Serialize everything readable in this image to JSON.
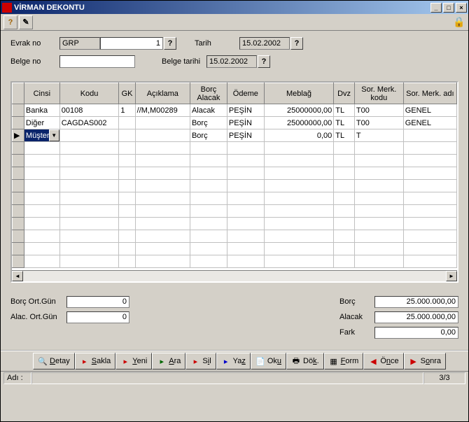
{
  "window": {
    "title": "VİRMAN DEKONTU"
  },
  "toolbar1": {
    "help": "?",
    "tool2": "✎"
  },
  "form": {
    "evrak_label": "Evrak no",
    "evrak_series": "GRP",
    "evrak_num": "1",
    "belge_label": "Belge no",
    "belge_value": "",
    "tarih_label": "Tarih",
    "tarih_value": "15.02.2002",
    "belge_tarihi_label": "Belge tarihi",
    "belge_tarihi_value": "15.02.2002"
  },
  "grid": {
    "headers": [
      "Cinsi",
      "Kodu",
      "GK",
      "Açıklama",
      "Borç Alacak",
      "Ödeme",
      "Meblağ",
      "Dvz",
      "Sor. Merk. kodu",
      "Sor. Merk. adı"
    ],
    "rows": [
      {
        "cinsi": "Banka",
        "kodu": "00108",
        "gk": "1",
        "aciklama": "//M,M00289",
        "ba": "Alacak",
        "odeme": "PEŞİN",
        "meblag": "25000000,00",
        "dvz": "TL",
        "smk": "T00",
        "sma": "GENEL"
      },
      {
        "cinsi": "Diğer",
        "kodu": "CAGDAS002",
        "gk": "",
        "aciklama": "",
        "ba": "Borç",
        "odeme": "PEŞİN",
        "meblag": "25000000,00",
        "dvz": "TL",
        "smk": "T00",
        "sma": "GENEL"
      },
      {
        "cinsi": "Müşteri",
        "kodu": "",
        "gk": "",
        "aciklama": "",
        "ba": "Borç",
        "odeme": "PEŞİN",
        "meblag": "0,00",
        "dvz": "TL",
        "smk": "T",
        "sma": ""
      }
    ]
  },
  "summary": {
    "borc_ort_label": "Borç Ort.Gün",
    "borc_ort_value": "0",
    "alac_ort_label": "Alac. Ort.Gün",
    "alac_ort_value": "0",
    "borc_label": "Borç",
    "borc_value": "25.000.000,00",
    "alacak_label": "Alacak",
    "alacak_value": "25.000.000,00",
    "fark_label": "Fark",
    "fark_value": "0,00"
  },
  "toolbar2": {
    "detay": "Detay",
    "sakla": "Sakla",
    "yeni": "Yeni",
    "ara": "Ara",
    "sil": "Sil",
    "yaz": "Yaz",
    "oku": "Oku",
    "dok": "Dök.",
    "form": "Form",
    "once": "Önce",
    "sonra": "Sonra"
  },
  "status": {
    "adi_label": "Adı :",
    "page": "3/3"
  }
}
